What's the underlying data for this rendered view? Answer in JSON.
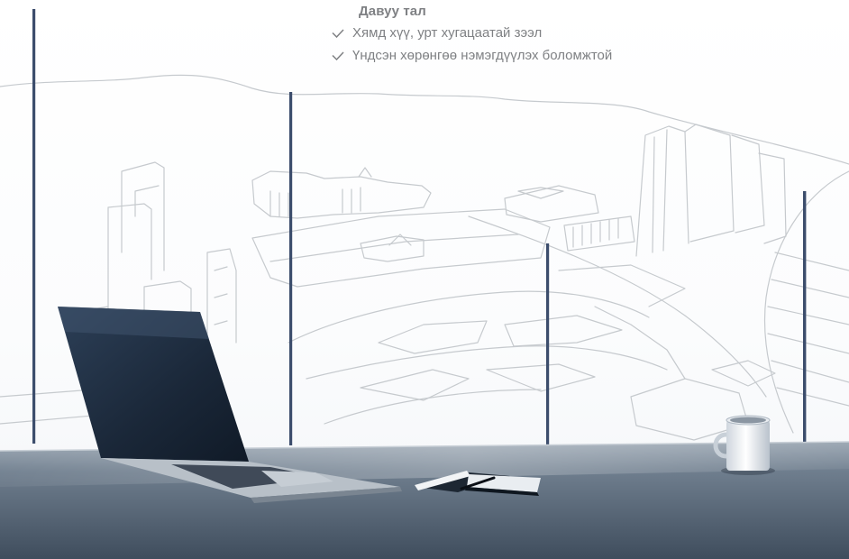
{
  "benefits": {
    "title": "Давуу тал",
    "items": [
      {
        "icon": "check-icon",
        "text": "Хямд хүү, урт хугацаатай зээл"
      },
      {
        "icon": "check-icon",
        "text": "Үндсэн хөрөнгөө нэмэгдүүлэх боломжтой"
      }
    ]
  },
  "colors": {
    "text": "#7f8184",
    "window_frame": "#3e4f6f",
    "sketch_line": "#c4c8cd",
    "desk_top": "#5d6c7c",
    "laptop": "#1c2a3a"
  }
}
